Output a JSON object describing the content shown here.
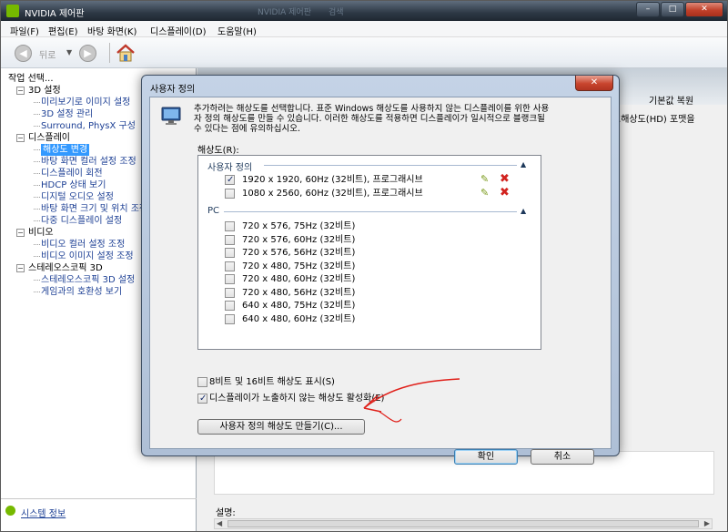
{
  "window": {
    "title": "NVIDIA 제어판",
    "ghost_tabs": [
      "NVIDIA 제어판",
      "검색"
    ]
  },
  "menu": [
    "파일(F)",
    "편집(E)",
    "바탕 화면(K)",
    "디스플레이(D)",
    "도움말(H)"
  ],
  "nav": {
    "back_label": "뒤로"
  },
  "task_pane": {
    "header": "작업 선택...",
    "tree": [
      {
        "label": "3D 설정",
        "level": 0
      },
      {
        "label": "미리보기로 이미지 설정",
        "level": 1
      },
      {
        "label": "3D 설정 관리",
        "level": 1
      },
      {
        "label": "Surround, PhysX 구성",
        "level": 1
      },
      {
        "label": "디스플레이",
        "level": 0
      },
      {
        "label": "해상도 변경",
        "level": 1,
        "selected": true
      },
      {
        "label": "바탕 화면 컬러 설정 조정",
        "level": 1
      },
      {
        "label": "디스플레이 회전",
        "level": 1
      },
      {
        "label": "HDCP 상태 보기",
        "level": 1
      },
      {
        "label": "디지털 오디오 설정",
        "level": 1
      },
      {
        "label": "바탕 화면 크기 및 위치 조정",
        "level": 1
      },
      {
        "label": "다중 디스플레이 설정",
        "level": 1
      },
      {
        "label": "비디오",
        "level": 0
      },
      {
        "label": "비디오 컬러 설정 조정",
        "level": 1
      },
      {
        "label": "비디오 이미지 설정 조정",
        "level": 1
      },
      {
        "label": "스테레오스코픽 3D",
        "level": 0
      },
      {
        "label": "스테레오스코픽 3D 설정",
        "level": 1
      },
      {
        "label": "게임과의 호환성 보기",
        "level": 1
      }
    ],
    "system_info": "시스템 정보"
  },
  "content": {
    "restore_label": "기본값 복원",
    "desc_right": "고해상도(HD) 포맷을",
    "desc_label": "설명:"
  },
  "dialog": {
    "title": "사용자 정의",
    "close": "✕",
    "intro_line1": "추가하려는 해상도를 선택합니다. 표준 Windows 해상도를 사용하지 않는 디스플레이를 위한 사용",
    "intro_line2": "자 정의 해상도를 만들 수 있습니다. 이러한 해상도를 적용하면 디스플레이가 일시적으로 블랭크될",
    "intro_line3": "수 있다는 점에 유의하십시오.",
    "resolution_label": "해상도(R):",
    "groups": [
      {
        "name": "사용자 정의",
        "items": [
          {
            "text": "1920 x 1920, 60Hz (32비트), 프로그래시브",
            "checked": true
          },
          {
            "text": "1080 x 2560, 60Hz (32비트), 프로그래시브",
            "checked": false
          }
        ]
      },
      {
        "name": "PC",
        "items": [
          {
            "text": "720 x 576, 75Hz (32비트)",
            "checked": false
          },
          {
            "text": "720 x 576, 60Hz (32비트)",
            "checked": false
          },
          {
            "text": "720 x 576, 56Hz (32비트)",
            "checked": false
          },
          {
            "text": "720 x 480, 75Hz (32비트)",
            "checked": false
          },
          {
            "text": "720 x 480, 60Hz (32비트)",
            "checked": false
          },
          {
            "text": "720 x 480, 56Hz (32비트)",
            "checked": false
          },
          {
            "text": "640 x 480, 75Hz (32비트)",
            "checked": false
          },
          {
            "text": "640 x 480, 60Hz (32비트)",
            "checked": false
          }
        ]
      }
    ],
    "option_8_16bit": {
      "label": "8비트 및 16비트 해상도 표시(S)",
      "checked": false
    },
    "option_hidden": {
      "label": "디스플레이가 노출하지 않는 해상도 활성화(E)",
      "checked": true
    },
    "create_button": "사용자 정의 해상도 만들기(C)...",
    "ok_button": "확인",
    "cancel_button": "취소"
  },
  "colors": {
    "selected": "#3399ff",
    "link": "#1c3f94",
    "nvidia_green": "#76b900",
    "annotation_red": "#e0201a",
    "delete_red": "#d2231f"
  }
}
